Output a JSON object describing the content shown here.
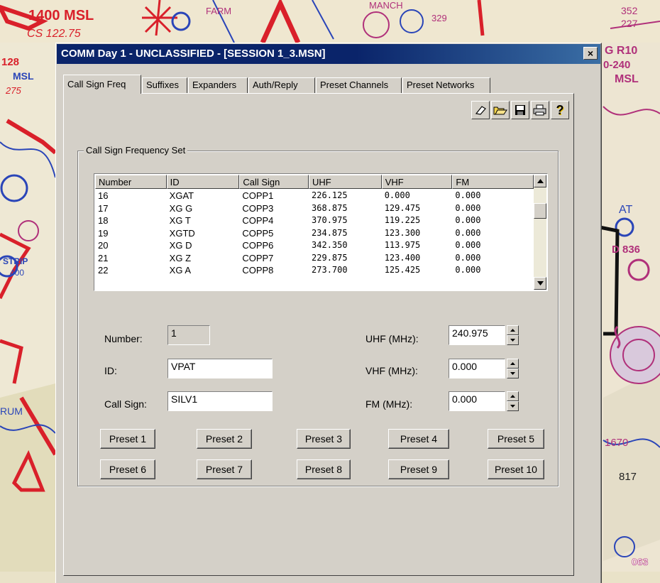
{
  "map_labels": {
    "top_left_1": "1400 MSL",
    "top_left_2": "CS 122.75",
    "farm": "FARM",
    "manch": "MANCH",
    "code_329": "329",
    "code_352": "352",
    "code_227": "227",
    "right_g": "G R10",
    "right_alt": "0-240",
    "right_msl": "MSL",
    "left_128": "128",
    "left_msl": "MSL",
    "left_275": "275",
    "right_at": "AT",
    "right_d836": "D 836",
    "right_1670": "1670",
    "right_817": "817",
    "right_063": "063",
    "left_strip": "STRIP",
    "left_400": "400",
    "left_rum": "RUM"
  },
  "window": {
    "title": "COMM Day 1 - UNCLASSIFIED - [SESSION 1_3.MSN]",
    "close_label": "×"
  },
  "tabs": [
    {
      "label": "Call Sign Freq",
      "active": true
    },
    {
      "label": "Suffixes"
    },
    {
      "label": "Expanders"
    },
    {
      "label": "Auth/Reply"
    },
    {
      "label": "Preset Channels"
    },
    {
      "label": "Preset Networks"
    }
  ],
  "toolbar": {
    "icons": [
      "eraser-icon",
      "open-folder-icon",
      "save-icon",
      "print-icon",
      "help-icon"
    ],
    "help_glyph": "?"
  },
  "group": {
    "title": "Call Sign Frequency Set"
  },
  "table": {
    "columns": [
      "Number",
      "ID",
      "Call Sign",
      "UHF",
      "VHF",
      "FM"
    ],
    "rows": [
      [
        "16",
        "XGAT",
        "COPP1",
        "226.125",
        "0.000",
        "0.000"
      ],
      [
        "17",
        "XG G",
        "COPP3",
        "368.875",
        "129.475",
        "0.000"
      ],
      [
        "18",
        "XG T",
        "COPP4",
        "370.975",
        "119.225",
        "0.000"
      ],
      [
        "19",
        "XGTD",
        "COPP5",
        "234.875",
        "123.300",
        "0.000"
      ],
      [
        "20",
        "XG D",
        "COPP6",
        "342.350",
        "113.975",
        "0.000"
      ],
      [
        "21",
        "XG Z",
        "COPP7",
        "229.875",
        "123.400",
        "0.000"
      ],
      [
        "22",
        "XG A",
        "COPP8",
        "273.700",
        "125.425",
        "0.000"
      ]
    ]
  },
  "form": {
    "number_label": "Number:",
    "number_value": "1",
    "id_label": "ID:",
    "id_value": "VPAT",
    "callsign_label": "Call Sign:",
    "callsign_value": "SILV1",
    "uhf_label": "UHF (MHz):",
    "uhf_value": "240.975",
    "vhf_label": "VHF (MHz):",
    "vhf_value": "0.000",
    "fm_label": "FM (MHz):",
    "fm_value": "0.000"
  },
  "presets": [
    "Preset 1",
    "Preset 2",
    "Preset 3",
    "Preset 4",
    "Preset 5",
    "Preset 6",
    "Preset 7",
    "Preset 8",
    "Preset 9",
    "Preset 10"
  ],
  "colors": {
    "titlebar": "#0a246a",
    "face": "#d4d0c8",
    "map_red": "#d9202a",
    "map_blue": "#2a45b8",
    "map_magenta": "#b0307a"
  }
}
